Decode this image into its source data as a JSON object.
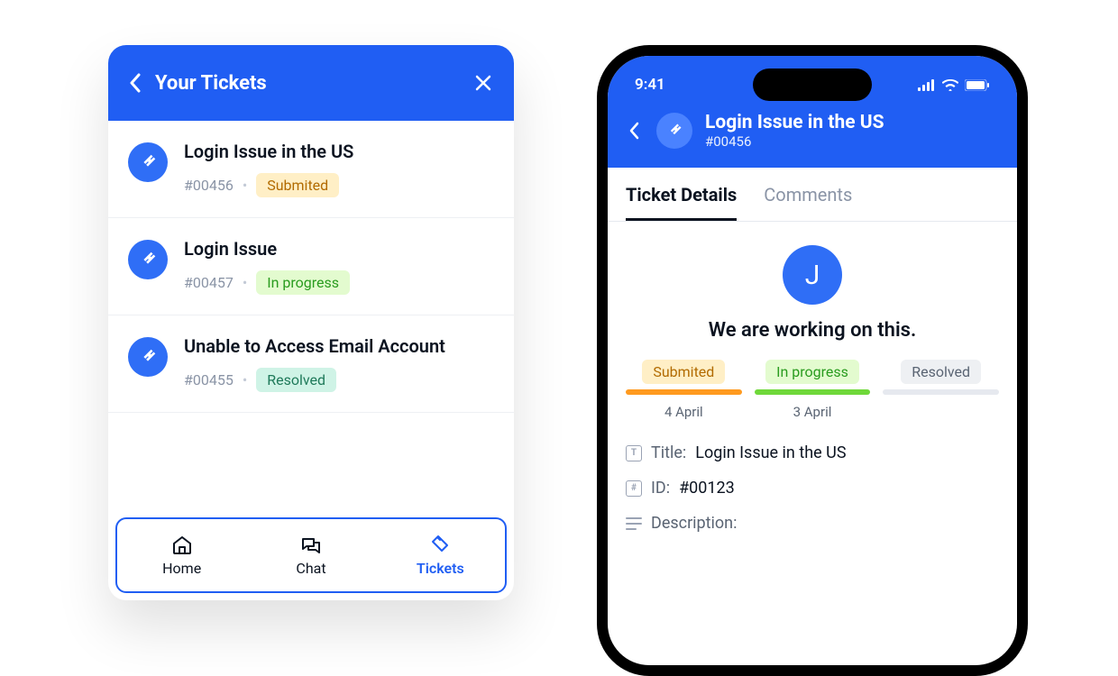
{
  "widget": {
    "title": "Your Tickets",
    "tickets": [
      {
        "title": "Login Issue in the US",
        "id": "#00456",
        "status": "Submited",
        "status_class": "badge-submited"
      },
      {
        "title": "Login Issue",
        "id": "#00457",
        "status": "In progress",
        "status_class": "badge-inprogress"
      },
      {
        "title": "Unable to Access Email Account",
        "id": "#00455",
        "status": "Resolved",
        "status_class": "badge-resolved"
      }
    ],
    "tabs": {
      "home": "Home",
      "chat": "Chat",
      "tickets": "Tickets"
    }
  },
  "phone": {
    "time": "9:41",
    "header_title": "Login Issue in the US",
    "header_id": "#00456",
    "tabs": {
      "details": "Ticket Details",
      "comments": "Comments"
    },
    "avatar_letter": "J",
    "status_line": "We are working on this.",
    "stages": [
      {
        "label": "Submited",
        "date": "4 April",
        "badge_class": "badge-submited",
        "bar_class": "bar-submited"
      },
      {
        "label": "In progress",
        "date": "3 April",
        "badge_class": "badge-inprogress",
        "bar_class": "bar-inprogress"
      },
      {
        "label": "Resolved",
        "date": "",
        "badge_class": "badge-resolved-grey",
        "bar_class": "bar-resolved"
      }
    ],
    "details": {
      "title_label": "Title:",
      "title_value": "Login Issue in the US",
      "id_label": "ID:",
      "id_value": "#00123",
      "desc_label": "Description:"
    }
  }
}
